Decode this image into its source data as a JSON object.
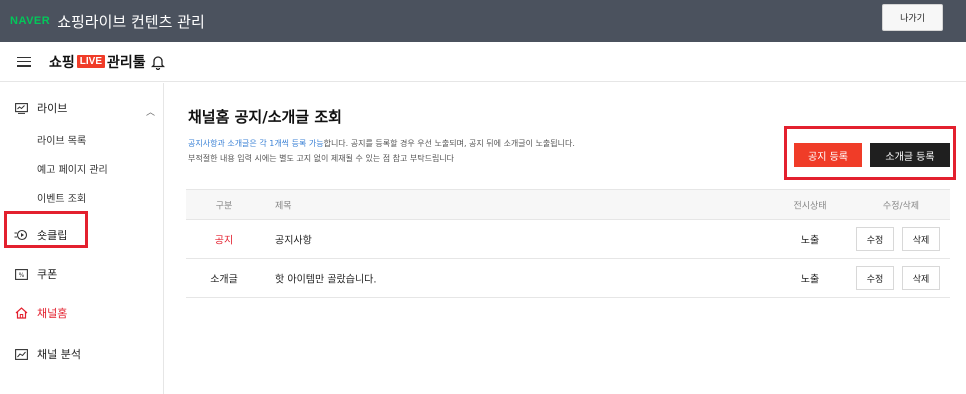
{
  "topbar": {
    "logo": "NAVER",
    "title": "쇼핑라이브 컨텐츠 관리",
    "exit_label": "나가기"
  },
  "header": {
    "brand_prefix": "쇼핑",
    "brand_live": "LIVE",
    "brand_suffix": "관리툴"
  },
  "sidebar": {
    "live": "라이브",
    "live_subs": [
      "라이브 목록",
      "예고 페이지 관리",
      "이벤트 조회"
    ],
    "shortclip": "숏클립",
    "coupon": "쿠폰",
    "channel_home": "채널홈",
    "channel_analytics": "채널 분석"
  },
  "main": {
    "title": "채널홈 공지/소개글 조회",
    "desc1_highlight": "공지사항과 소개글은 각 1개씩 등록 가능",
    "desc1_rest": "합니다. 공지를 등록할 경우 우선 노출되며, 공지 뒤에 소개글이 노출됩니다.",
    "desc2": "부적절한 내용 입력 시에는 별도 고지 없이 제재될 수 있는 점 참고 부탁드립니다",
    "btn_notice": "공지 등록",
    "btn_intro": "소개글 등록"
  },
  "table": {
    "headers": {
      "kind": "구분",
      "title": "제목",
      "status": "전시상태",
      "actions": "수정/삭제"
    },
    "rows": [
      {
        "kind": "공지",
        "title": "공지사항",
        "status": "노출",
        "edit": "수정",
        "delete": "삭제"
      },
      {
        "kind": "소개글",
        "title": "핫 아이템만 골랐습니다.",
        "status": "노출",
        "edit": "수정",
        "delete": "삭제"
      }
    ]
  },
  "colors": {
    "topbar_bg": "#4b525e",
    "naver_green": "#03c75a",
    "accent_red": "#f03c28",
    "highlight_blue": "#3b82d6"
  }
}
